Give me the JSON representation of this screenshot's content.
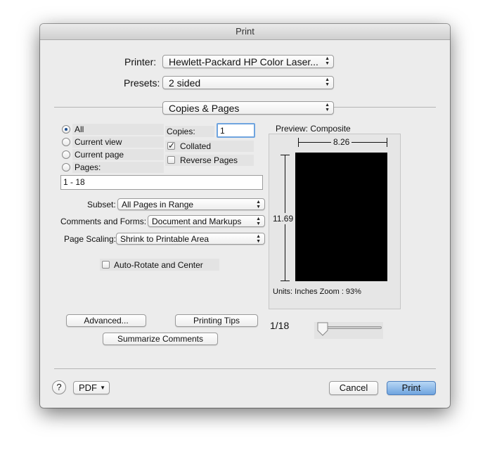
{
  "window": {
    "title": "Print"
  },
  "printer": {
    "label": "Printer:",
    "value": "Hewlett-Packard HP Color Laser..."
  },
  "presets": {
    "label": "Presets:",
    "value": "2 sided"
  },
  "section": {
    "value": "Copies & Pages"
  },
  "pages": {
    "options": [
      "All",
      "Current view",
      "Current page",
      "Pages:"
    ],
    "selected": "All",
    "range": "1 - 18"
  },
  "copies": {
    "label": "Copies:",
    "value": "1",
    "collated_label": "Collated",
    "collated": true,
    "reverse_label": "Reverse Pages",
    "reverse": false
  },
  "subset": {
    "label": "Subset:",
    "value": "All Pages in Range"
  },
  "comments": {
    "label": "Comments and Forms:",
    "value": "Document and Markups"
  },
  "scaling": {
    "label": "Page Scaling:",
    "value": "Shrink to Printable Area"
  },
  "autorotate": {
    "label": "Auto-Rotate and Center",
    "checked": false
  },
  "preview": {
    "title": "Preview: Composite",
    "width": "8.26",
    "height": "11.69",
    "units": "Units: Inches Zoom :  93%",
    "page": "1/18"
  },
  "buttons": {
    "advanced": "Advanced...",
    "tips": "Printing Tips",
    "summarize": "Summarize Comments",
    "help": "?",
    "pdf": "PDF",
    "cancel": "Cancel",
    "print": "Print"
  },
  "colors": {
    "accent": "#6fa4df",
    "preview_page": "#000000"
  }
}
